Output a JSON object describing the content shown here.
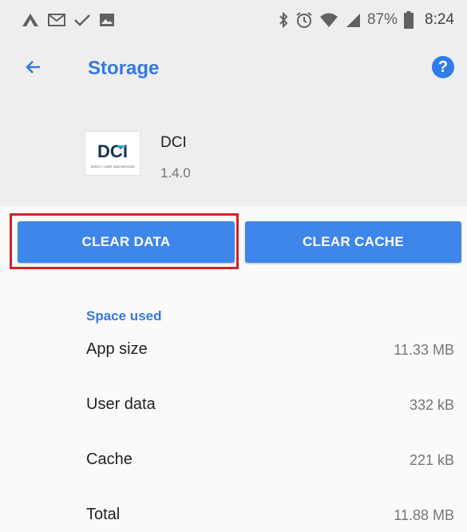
{
  "status_bar": {
    "battery_text": "87%",
    "time": "8:24"
  },
  "toolbar": {
    "title": "Storage",
    "help_label": "?"
  },
  "app": {
    "name": "DCI",
    "version": "1.4.0",
    "logo_text": "DCI",
    "logo_subtext": "DIRECT CARE INNOVATIONS"
  },
  "buttons": {
    "clear_data": "CLEAR DATA",
    "clear_cache": "CLEAR CACHE"
  },
  "space_used": {
    "header": "Space used",
    "rows": [
      {
        "label": "App size",
        "value": "11.33 MB"
      },
      {
        "label": "User data",
        "value": "332 kB"
      },
      {
        "label": "Cache",
        "value": "221 kB"
      },
      {
        "label": "Total",
        "value": "11.88 MB"
      }
    ]
  },
  "colors": {
    "accent": "#3478e6",
    "button": "#3f86ea",
    "highlight": "#d32222",
    "header_bg": "#eeeeee"
  },
  "icons": {
    "status_left": [
      "notification-a-icon",
      "gmail-icon",
      "check-icon",
      "image-icon"
    ],
    "status_right": [
      "bluetooth-icon",
      "alarm-icon",
      "wifi-icon",
      "signal-icon",
      "battery-icon"
    ],
    "back": "arrow-left-icon",
    "help": "help-icon"
  }
}
